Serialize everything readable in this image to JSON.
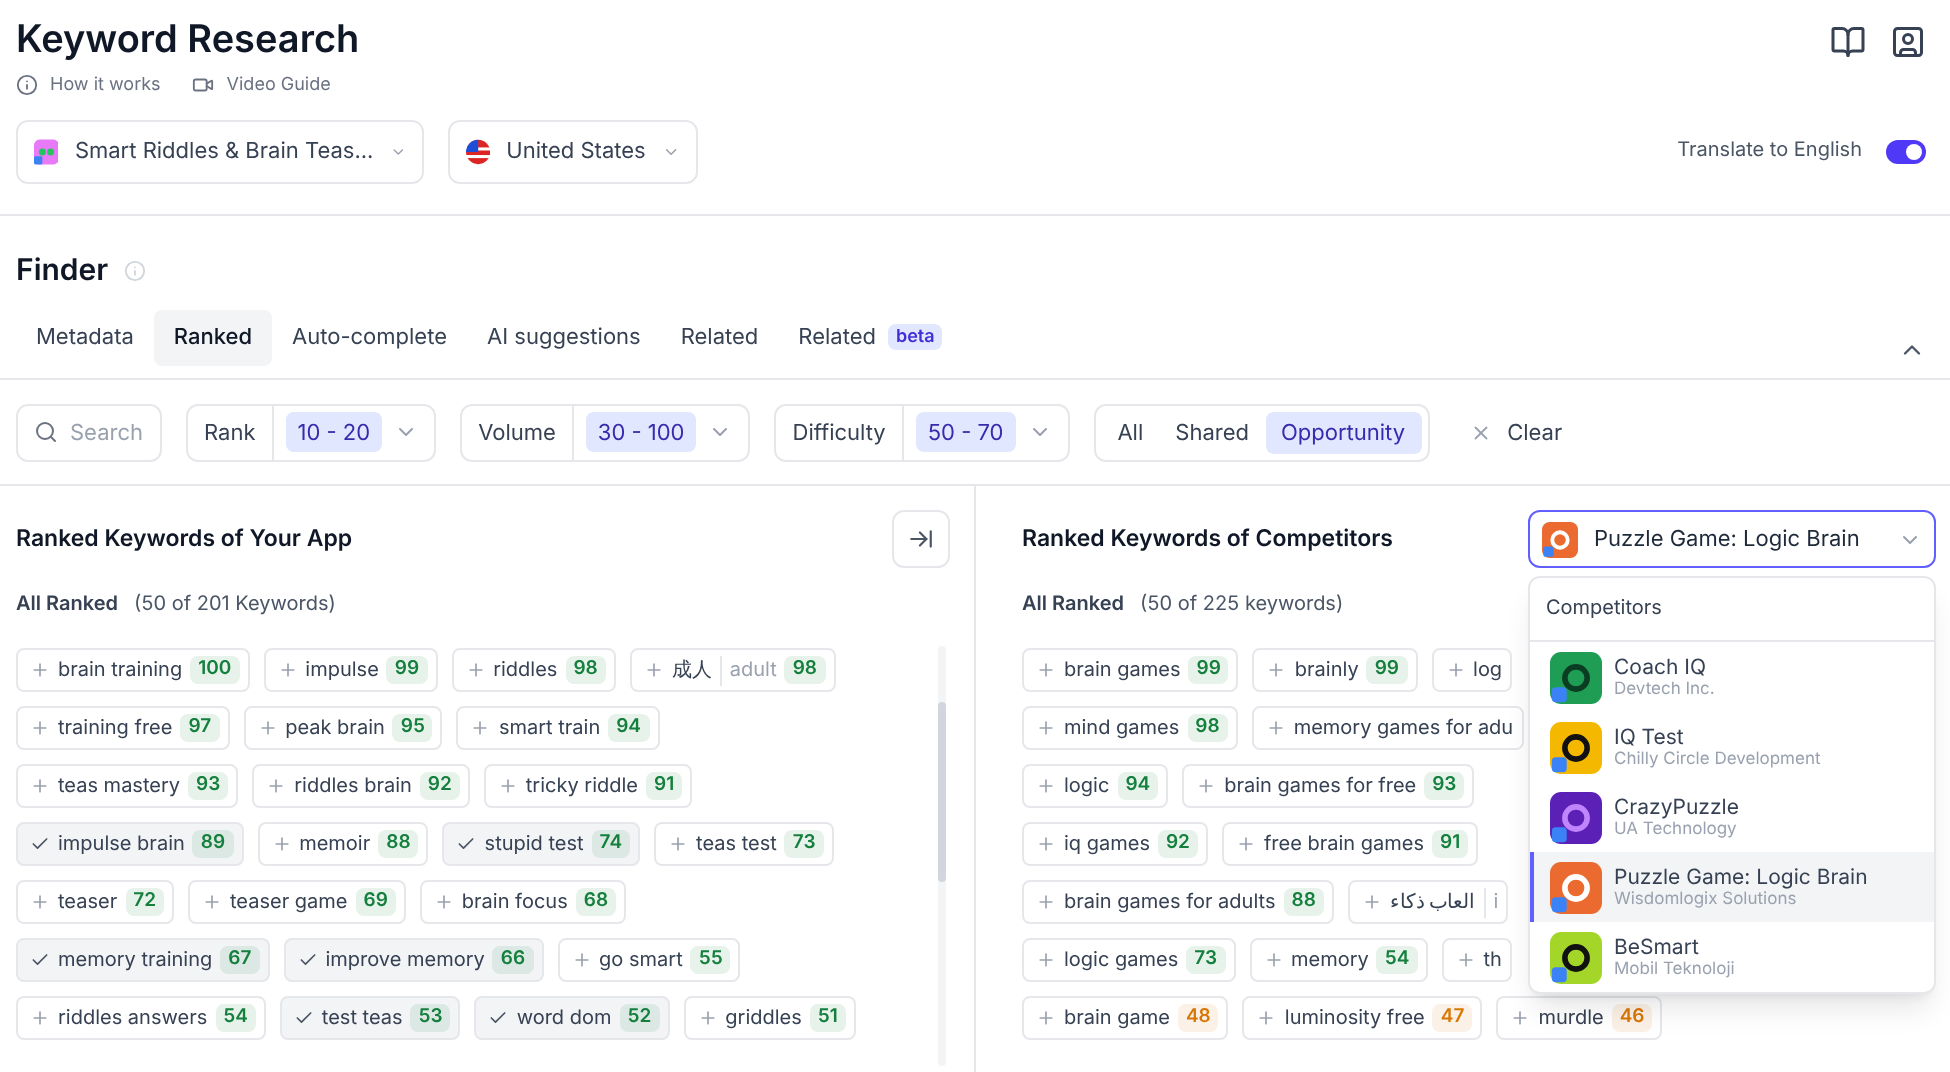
{
  "header": {
    "title": "Keyword Research",
    "links": [
      {
        "kind": "info",
        "label": "How it works"
      },
      {
        "kind": "video",
        "label": "Video Guide"
      }
    ]
  },
  "app_select": {
    "value": "Smart Riddles & Brain Teas..."
  },
  "country_select": {
    "value": "United States"
  },
  "translate": {
    "label": "Translate to English",
    "on": true
  },
  "finder": {
    "title": "Finder",
    "tabs": [
      {
        "label": "Metadata",
        "selected": false
      },
      {
        "label": "Ranked",
        "selected": true
      },
      {
        "label": "Auto-complete",
        "selected": false
      },
      {
        "label": "AI suggestions",
        "selected": false
      },
      {
        "label": "Related",
        "selected": false
      },
      {
        "label": "Related",
        "badge": "beta",
        "selected": false
      }
    ]
  },
  "filters": {
    "search_placeholder": "Search",
    "ranges": [
      {
        "label": "Rank",
        "value": "10 - 20"
      },
      {
        "label": "Volume",
        "value": "30 - 100"
      },
      {
        "label": "Difficulty",
        "value": "50 - 70"
      }
    ],
    "segments": [
      {
        "label": "All",
        "selected": false
      },
      {
        "label": "Shared",
        "selected": false
      },
      {
        "label": "Opportunity",
        "selected": true
      }
    ],
    "clear": "Clear"
  },
  "your_app": {
    "title": "Ranked Keywords of Your App",
    "subtitle": "All Ranked",
    "count": "(50 of 201 Keywords)",
    "rows": [
      [
        {
          "text": "brain training",
          "score": "100",
          "color": "#15803d",
          "selected": false
        },
        {
          "text": "impulse",
          "score": "99",
          "color": "#15803d",
          "selected": false
        },
        {
          "text": "riddles",
          "score": "98",
          "color": "#15803d",
          "selected": false
        },
        {
          "text": "成人",
          "translation": "adult",
          "score": "98",
          "color": "#15803d",
          "selected": false
        }
      ],
      [
        {
          "text": "training free",
          "score": "97",
          "color": "#15803d",
          "selected": false
        },
        {
          "text": "peak brain",
          "score": "95",
          "color": "#15803d",
          "selected": false
        },
        {
          "text": "smart train",
          "score": "94",
          "color": "#15803d",
          "selected": false
        }
      ],
      [
        {
          "text": "teas mastery",
          "score": "93",
          "color": "#15803d",
          "selected": false
        },
        {
          "text": "riddles brain",
          "score": "92",
          "color": "#15803d",
          "selected": false
        },
        {
          "text": "tricky riddle",
          "score": "91",
          "color": "#15803d",
          "selected": false
        }
      ],
      [
        {
          "text": "impulse brain",
          "score": "89",
          "color": "#15803d",
          "selected": true
        },
        {
          "text": "memoir",
          "score": "88",
          "color": "#15803d",
          "selected": false
        },
        {
          "text": "stupid test",
          "score": "74",
          "color": "#15803d",
          "selected": true
        },
        {
          "text": "teas test",
          "score": "73",
          "color": "#15803d",
          "selected": false
        }
      ],
      [
        {
          "text": "teaser",
          "score": "72",
          "color": "#15803d",
          "selected": false
        },
        {
          "text": "teaser game",
          "score": "69",
          "color": "#15803d",
          "selected": false
        },
        {
          "text": "brain focus",
          "score": "68",
          "color": "#15803d",
          "selected": false
        }
      ],
      [
        {
          "text": "memory training",
          "score": "67",
          "color": "#15803d",
          "selected": true
        },
        {
          "text": "improve memory",
          "score": "66",
          "color": "#15803d",
          "selected": true
        },
        {
          "text": "go smart",
          "score": "55",
          "color": "#15803d",
          "selected": false
        }
      ],
      [
        {
          "text": "riddles answers",
          "score": "54",
          "color": "#15803d",
          "selected": false
        },
        {
          "text": "test teas",
          "score": "53",
          "color": "#15803d",
          "selected": true
        },
        {
          "text": "word dom",
          "score": "52",
          "color": "#15803d",
          "selected": true
        },
        {
          "text": "griddles",
          "score": "51",
          "color": "#15803d",
          "selected": false
        }
      ]
    ]
  },
  "competitors": {
    "title": "Ranked Keywords of Competitors",
    "subtitle": "All Ranked",
    "count": "(50 of 225 keywords)",
    "rows": [
      [
        {
          "text": "brain games",
          "score": "99",
          "color": "#15803d",
          "selected": false
        },
        {
          "text": "brainly",
          "score": "99",
          "color": "#15803d",
          "selected": false
        },
        {
          "text": "log",
          "selected": false
        }
      ],
      [
        {
          "text": "mind games",
          "score": "98",
          "color": "#15803d",
          "selected": false
        },
        {
          "text": "memory games for adu",
          "selected": false
        }
      ],
      [
        {
          "text": "logic",
          "score": "94",
          "color": "#15803d",
          "selected": false
        },
        {
          "text": "brain games for free",
          "score": "93",
          "color": "#15803d",
          "selected": false
        }
      ],
      [
        {
          "text": "iq games",
          "score": "92",
          "color": "#15803d",
          "selected": false
        },
        {
          "text": "free brain games",
          "score": "91",
          "color": "#15803d",
          "selected": false
        }
      ],
      [
        {
          "text": "brain games for adults",
          "score": "88",
          "color": "#15803d",
          "selected": false
        },
        {
          "text": "العاب ذكاء",
          "translation": "i",
          "selected": false
        }
      ],
      [
        {
          "text": "logic games",
          "score": "73",
          "color": "#15803d",
          "selected": false
        },
        {
          "text": "memory",
          "score": "54",
          "color": "#15803d",
          "selected": false
        },
        {
          "text": "th",
          "selected": false
        }
      ],
      [
        {
          "text": "brain game",
          "score": "48",
          "color": "#d97706",
          "selected": false
        },
        {
          "text": "luminosity free",
          "score": "47",
          "color": "#d97706",
          "selected": false
        },
        {
          "text": "murdle",
          "score": "46",
          "color": "#d97706",
          "selected": false
        }
      ]
    ],
    "select": {
      "value": "Puzzle Game: Logic Brain"
    },
    "menu": {
      "heading": "Competitors",
      "items": [
        {
          "name": "Coach IQ",
          "developer": "Devtech Inc.",
          "selected": false
        },
        {
          "name": "IQ Test",
          "developer": "Chilly Circle Development",
          "selected": false
        },
        {
          "name": "CrazyPuzzle",
          "developer": "UA Technology",
          "selected": false
        },
        {
          "name": "Puzzle Game: Logic Brain",
          "developer": "Wisdomlogix Solutions",
          "selected": true
        },
        {
          "name": "BeSmart",
          "developer": "Mobil Teknoloji",
          "selected": false
        }
      ]
    }
  }
}
